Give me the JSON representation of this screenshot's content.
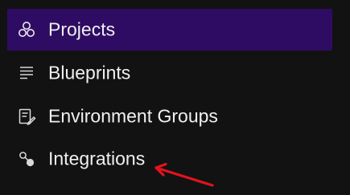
{
  "sidebar": {
    "items": [
      {
        "label": "Projects",
        "icon": "projects-icon",
        "active": true
      },
      {
        "label": "Blueprints",
        "icon": "blueprints-icon",
        "active": false
      },
      {
        "label": "Environment Groups",
        "icon": "environment-groups-icon",
        "active": false
      },
      {
        "label": "Integrations",
        "icon": "integrations-icon",
        "active": false
      }
    ]
  },
  "colors": {
    "background": "#121212",
    "active_item": "#2f0c63",
    "text": "#f0f0f0",
    "annotation_arrow": "#e0141e"
  }
}
